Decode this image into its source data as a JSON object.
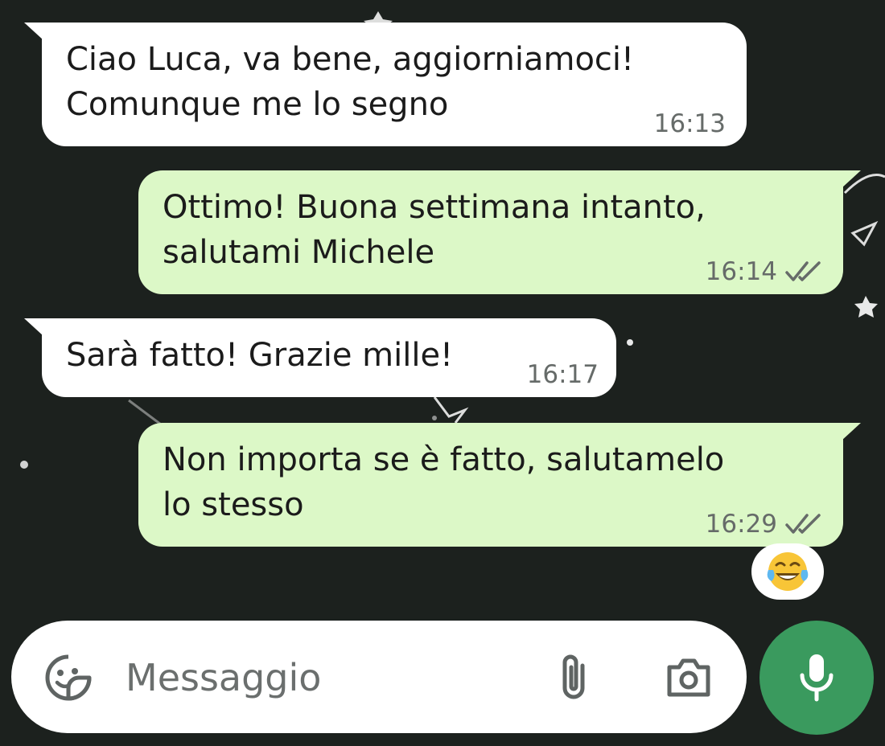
{
  "messages": [
    {
      "direction": "incoming",
      "text": "Ciao Luca, va bene, aggiorniamoci!\nComunque me lo segno",
      "time": "16:13"
    },
    {
      "direction": "outgoing",
      "text": "Ottimo! Buona settimana intanto,\nsalutami Michele",
      "time": "16:14",
      "status": "read"
    },
    {
      "direction": "incoming",
      "text": "Sarà fatto! Grazie mille!",
      "time": "16:17"
    },
    {
      "direction": "outgoing",
      "text": "Non importa se è fatto, salutamelo\nlo stesso",
      "time": "16:29",
      "status": "read",
      "reaction": "face-with-tears-of-joy"
    }
  ],
  "composer": {
    "placeholder": "Messaggio",
    "icons": [
      "sticker-icon",
      "paperclip-icon",
      "camera-icon"
    ]
  },
  "mic_button": {
    "icon": "microphone-icon"
  },
  "colors": {
    "background": "#1c211e",
    "incoming_bubble": "#ffffff",
    "outgoing_bubble": "#dcf8c7",
    "read_ticks": "#666b69",
    "mic_button": "#3a9a5e"
  }
}
